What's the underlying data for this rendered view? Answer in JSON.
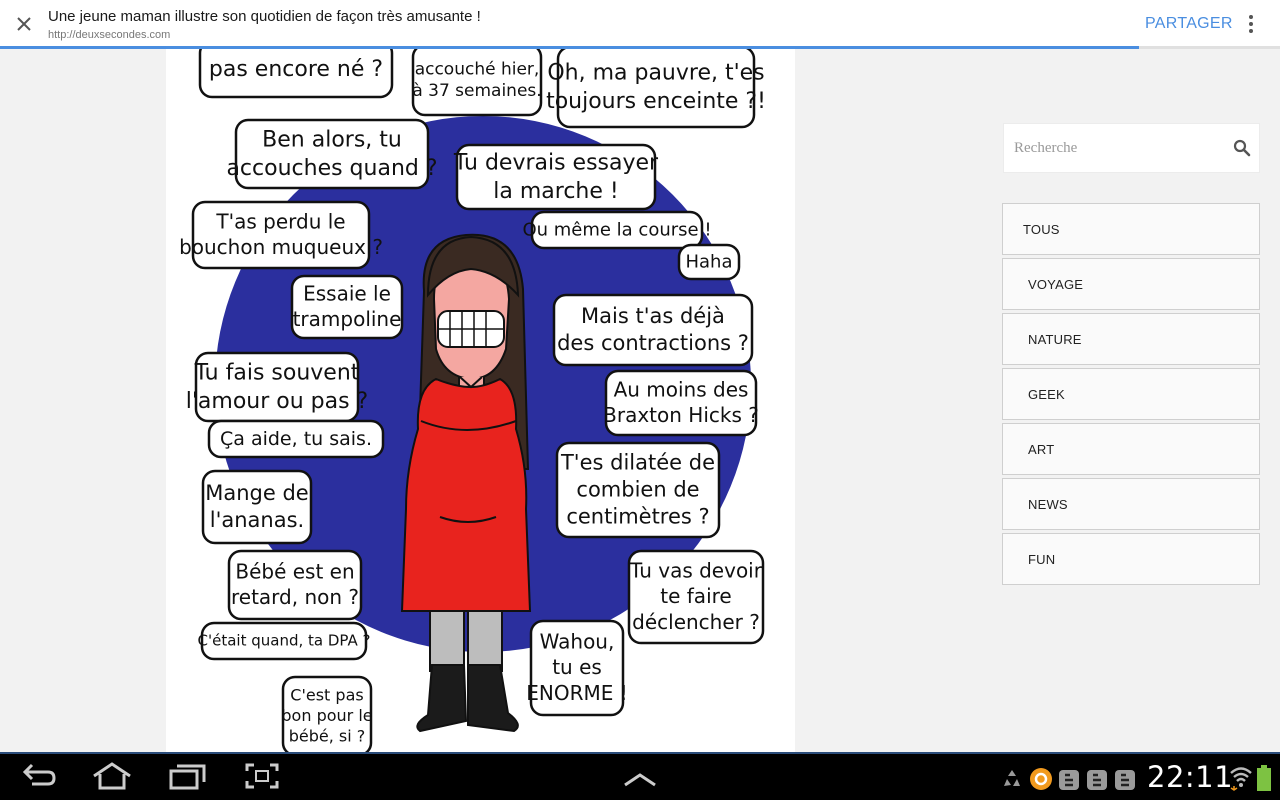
{
  "topbar": {
    "title": "Une jeune maman illustre son quotidien de façon très amusante !",
    "url": "http://deuxsecondes.com",
    "share_label": "PARTAGER",
    "load_progress_percent": 89
  },
  "search": {
    "placeholder": "Recherche"
  },
  "categories": [
    {
      "label": "TOUS"
    },
    {
      "label": "VOYAGE"
    },
    {
      "label": "NATURE"
    },
    {
      "label": "GEEK"
    },
    {
      "label": "ART"
    },
    {
      "label": "NEWS"
    },
    {
      "label": "FUN"
    }
  ],
  "comic": {
    "bubbles": [
      [
        "pas encore né ?"
      ],
      [
        "accouché hier,",
        "à 37 semaines."
      ],
      [
        "Oh, ma pauvre, t'es",
        "toujours enceinte ?!"
      ],
      [
        "Ben alors, tu",
        "accouches quand ?"
      ],
      [
        "Tu devrais essayer",
        "la marche !"
      ],
      [
        "T'as perdu le",
        "bouchon muqueux ?"
      ],
      [
        "Ou même la course !"
      ],
      [
        "Haha"
      ],
      [
        "Essaie le",
        "trampoline"
      ],
      [
        "Mais t'as déjà",
        "des contractions ?"
      ],
      [
        "Tu fais souvent",
        "l'amour ou pas ?"
      ],
      [
        "Au moins des",
        "Braxton Hicks ?"
      ],
      [
        "Ça aide, tu sais."
      ],
      [
        "T'es dilatée de",
        "combien de",
        "centimètres ?"
      ],
      [
        "Mange de",
        "l'ananas."
      ],
      [
        "Bébé est en",
        "retard, non ?"
      ],
      [
        "Tu vas devoir",
        "te faire",
        "déclencher ?"
      ],
      [
        "C'était quand, ta DPA ?"
      ],
      [
        "Wahou,",
        "tu es",
        "ENORME !"
      ],
      [
        "C'est pas",
        "bon pour le",
        "bébé, si ?"
      ]
    ]
  },
  "statusbar": {
    "time": "22:11"
  },
  "colors": {
    "accent": "#4a8ee0",
    "comic_blue": "#2b2f9e",
    "dress_red": "#e8231e",
    "battery_green": "#7dc242"
  },
  "icons": [
    "close-icon",
    "more-vert-icon",
    "search-icon",
    "back-icon",
    "home-icon",
    "recent-apps-icon",
    "screenshot-icon",
    "chevron-up-icon",
    "recycle-icon",
    "app-orange-icon",
    "blogger-icon",
    "wifi-icon",
    "battery-icon"
  ]
}
